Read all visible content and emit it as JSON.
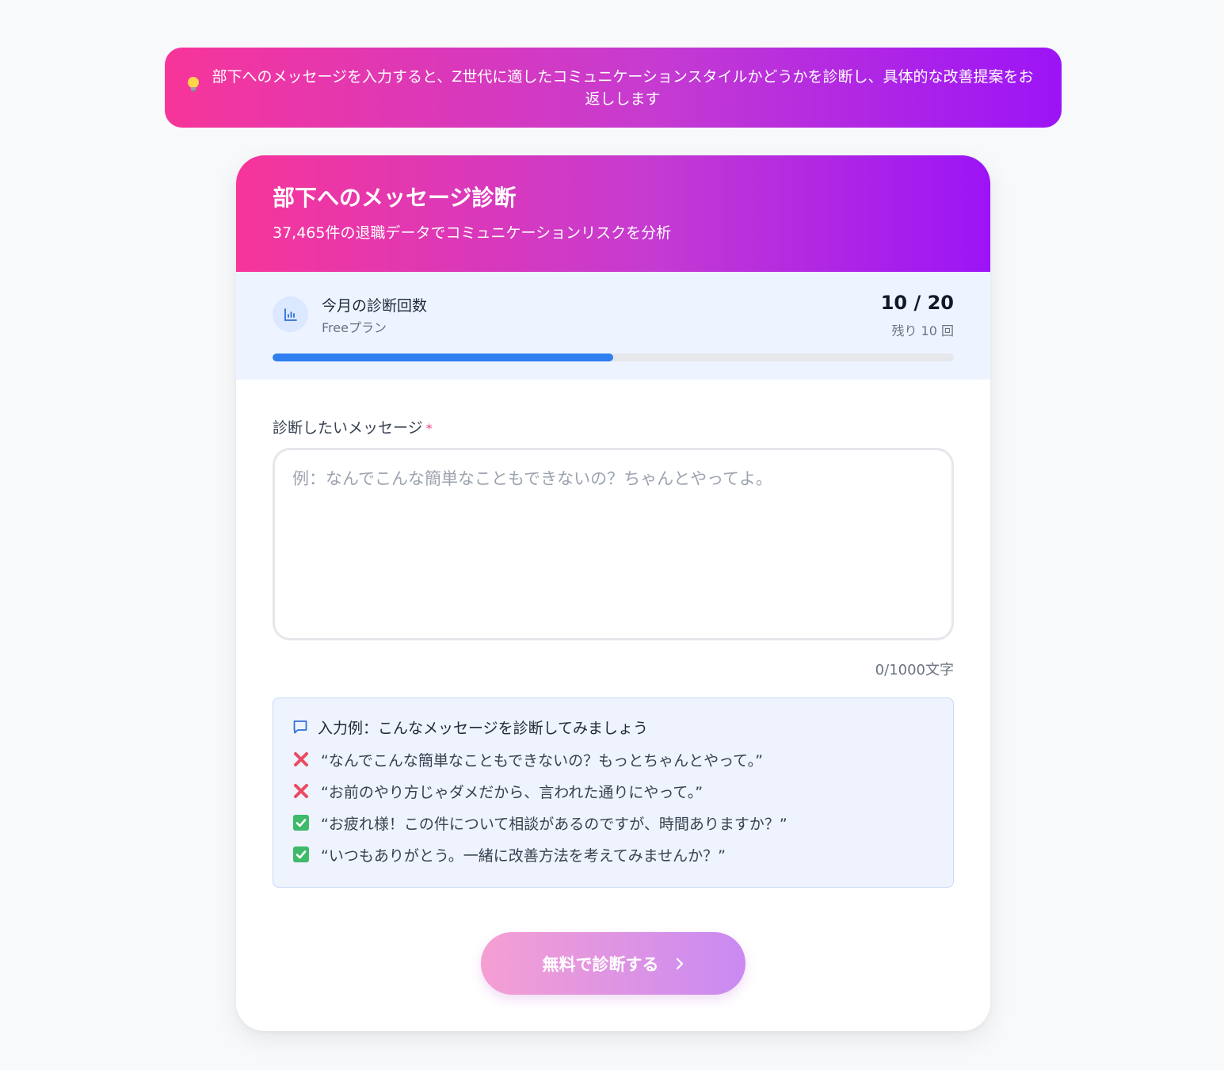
{
  "banner": {
    "icon": "lightbulb-icon",
    "text": "部下へのメッセージを入力すると、Z世代に適したコミュニケーションスタイルかどうかを診断し、具体的な改善提案をお返しします"
  },
  "card": {
    "title": "部下へのメッセージ診断",
    "subtitle": "37,465件の退職データでコミュニケーションリスクを分析"
  },
  "usage": {
    "icon": "bar-chart-icon",
    "label": "今月の診断回数",
    "plan": "Freeプラン",
    "count": "10 / 20",
    "remaining": "残り 10 回",
    "progress": 0.5,
    "accent": "#2f7ff0"
  },
  "form": {
    "label": "診断したいメッセージ",
    "required_mark": "*",
    "value": "",
    "placeholder": "例：なんでこんな簡単なこともできないの？ちゃんとやってよ。",
    "char_count": "0/1000文字"
  },
  "examples": {
    "icon": "chat-bubble-icon",
    "title": "入力例：こんなメッセージを診断してみましょう",
    "items": [
      {
        "status": "bad",
        "icon": "cross-mark-icon",
        "text": "“なんでこんな簡単なこともできないの？もっとちゃんとやって。”"
      },
      {
        "status": "bad",
        "icon": "cross-mark-icon",
        "text": "“お前のやり方じゃダメだから、言われた通りにやって。”"
      },
      {
        "status": "good",
        "icon": "check-mark-icon",
        "text": "“お疲れ様！この件について相談があるのですが、時間ありますか？”"
      },
      {
        "status": "good",
        "icon": "check-mark-icon",
        "text": "“いつもありがとう。一緒に改善方法を考えてみませんか？”"
      }
    ]
  },
  "submit": {
    "label": "無料で診断する",
    "icon": "chevron-right-icon"
  },
  "colors": {
    "gradient_start": "#f7359a",
    "gradient_end": "#9c14f6",
    "bad": "#e94b63",
    "good": "#3fb96a"
  }
}
